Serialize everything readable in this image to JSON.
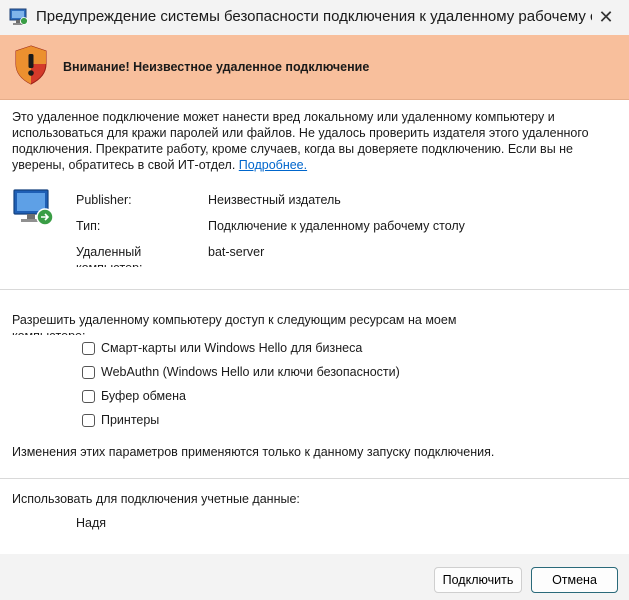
{
  "window": {
    "title": "Предупреждение системы безопасности подключения к удаленному рабочему столу",
    "close_glyph": "✕"
  },
  "banner": {
    "text": "Внимание! Неизвестное удаленное подключение",
    "color": "#f8bf9c"
  },
  "description": {
    "text": "Это удаленное подключение может нанести вред локальному или удаленному компьютеру и использоваться для кражи паролей или файлов. Не удалось проверить издателя этого удаленного подключения. Прекратите работу, кроме случаев, когда вы доверяете подключению. Если вы не уверены, обратитесь в свой ИТ-отдел.",
    "link": "Подробнее."
  },
  "info": {
    "publisher_label": "Publisher:",
    "publisher_value": "Неизвестный издатель",
    "type_label": "Тип:",
    "type_value": "Подключение к удаленному рабочему столу",
    "computer_label": "Удаленный компьютер:",
    "computer_value": "bat-server"
  },
  "resources": {
    "title": "Разрешить удаленному компьютеру доступ к следующим ресурсам на моем компьютере:",
    "items": [
      {
        "label": "Смарт-карты или Windows Hello для бизнеса",
        "checked": false
      },
      {
        "label": "WebAuthn (Windows Hello или ключи безопасности)",
        "checked": false
      },
      {
        "label": "Буфер обмена",
        "checked": false
      },
      {
        "label": "Принтеры",
        "checked": false
      }
    ],
    "note": "Изменения этих параметров применяются только к данному запуску подключения."
  },
  "credentials": {
    "label": "Использовать для подключения учетные данные:",
    "user": "Надя"
  },
  "buttons": {
    "connect": "Подключить",
    "cancel": "Отмена"
  }
}
